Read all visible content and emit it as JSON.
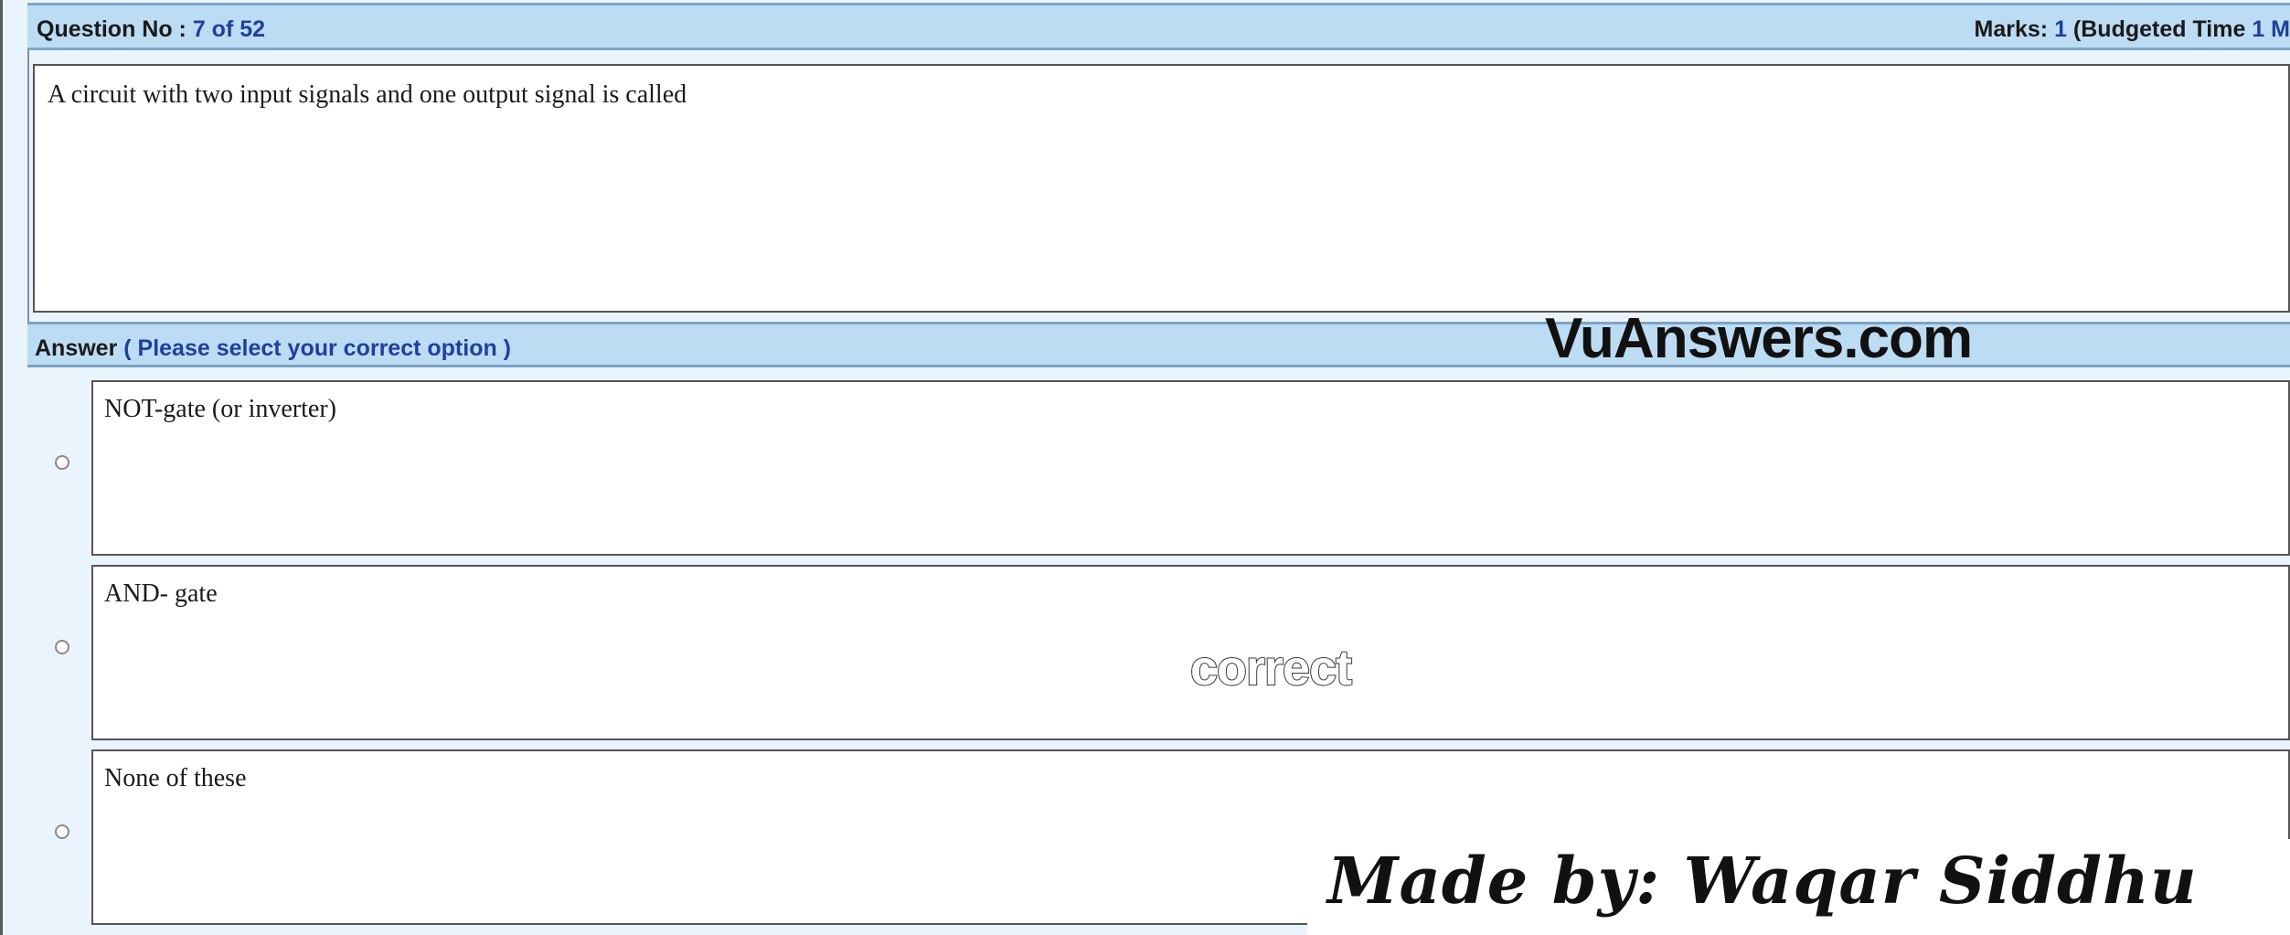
{
  "header": {
    "question_label": "Question No : ",
    "question_number": "7 of 52",
    "marks_label": "Marks: ",
    "marks_value": "1",
    "budgeted_label": " (Budgeted Time ",
    "budgeted_value": "1 M"
  },
  "question": {
    "text": "A circuit with two input signals and one output signal is called"
  },
  "answer": {
    "label": "Answer",
    "hint": " ( Please select your correct option )"
  },
  "options": [
    {
      "text": "NOT-gate (or inverter)",
      "selected": false
    },
    {
      "text": "AND- gate",
      "selected": false
    },
    {
      "text": "None of these",
      "selected": false
    }
  ],
  "watermarks": {
    "site": "VuAnswers.com",
    "correct": "correct",
    "made_by": "Made by: Waqar Siddhu"
  }
}
